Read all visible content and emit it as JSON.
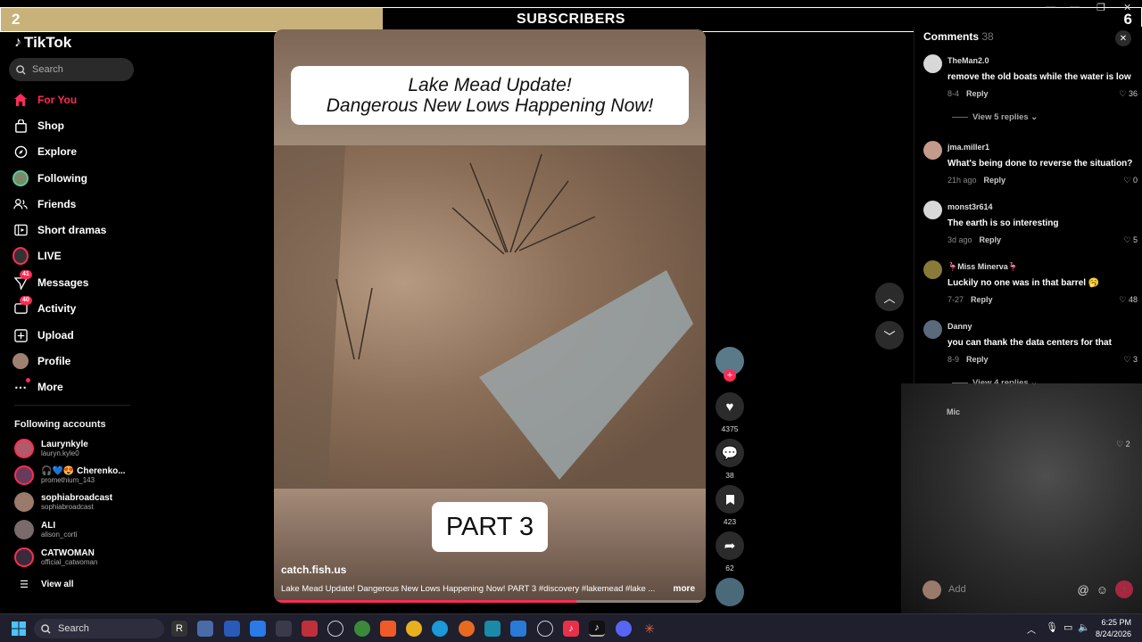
{
  "overlay": {
    "left_num": "2",
    "right_num": "6",
    "center": "SUBSCRIBERS",
    "progress_fraction": 0.335
  },
  "app": {
    "name": "TikTok"
  },
  "search": {
    "placeholder": "Search"
  },
  "nav": [
    {
      "label": "For You",
      "icon": "home-icon",
      "active": true
    },
    {
      "label": "Shop",
      "icon": "shop-bag-icon"
    },
    {
      "label": "Explore",
      "icon": "compass-icon"
    },
    {
      "label": "Following",
      "icon": "avatar-icon"
    },
    {
      "label": "Friends",
      "icon": "friends-icon"
    },
    {
      "label": "Short dramas",
      "icon": "film-icon"
    },
    {
      "label": "LIVE",
      "icon": "live-icon"
    },
    {
      "label": "Messages",
      "icon": "paper-plane-icon",
      "badge": "41"
    },
    {
      "label": "Activity",
      "icon": "inbox-icon",
      "badge": "40"
    },
    {
      "label": "Upload",
      "icon": "plus-square-icon"
    },
    {
      "label": "Profile",
      "icon": "avatar-icon"
    },
    {
      "label": "More",
      "icon": "ellipsis-icon"
    }
  ],
  "following_accounts": {
    "title": "Following accounts",
    "items": [
      {
        "name": "Laurynkyle",
        "handle": "lauryn.kyle0"
      },
      {
        "name": "🎧💙😍 Cherenko...",
        "handle": "promethium_143"
      },
      {
        "name": "sophiabroadcast",
        "handle": "sophiabroadcast"
      },
      {
        "name": "ALI",
        "handle": "alison_corti"
      },
      {
        "name": "CATWOMAN",
        "handle": "official_catwoman"
      }
    ],
    "view_all": "View all"
  },
  "video": {
    "title_line1": "Lake Mead Update!",
    "title_line2": "Dangerous New Lows Happening Now!",
    "part_label": "PART 3",
    "author": "catch.fish.us",
    "description": "Lake Mead Update! Dangerous New Lows Happening Now! PART 3 #discovery #lakemead #lake ...",
    "more": "more",
    "progress_fraction": 0.7
  },
  "actions": {
    "likes": "4375",
    "comments": "38",
    "saves": "423",
    "shares": "62"
  },
  "comments": {
    "title": "Comments",
    "count": "38",
    "reply_label": "Reply",
    "items": [
      {
        "user": "TheMan2.0",
        "text": "remove the old boats while the water is low",
        "date": "8-4",
        "likes": "36",
        "avatar_color": "#d8d8d8"
      },
      {
        "user": "jma.miller1",
        "text": "What's being done to reverse the situation?",
        "date": "21h ago",
        "likes": "0",
        "avatar_color": "#c49a8a"
      },
      {
        "user": "monst3r614",
        "text": "The earth is so interesting",
        "date": "3d ago",
        "likes": "5",
        "avatar_color": "#d8d8d8"
      },
      {
        "user": "🦩Miss Minerva🦩",
        "text": "Luckily no one was in that barrel 🥱",
        "date": "7-27",
        "likes": "48",
        "avatar_color": "#8a7a3a"
      },
      {
        "user": "Danny",
        "text": "you can thank the data centers for that",
        "date": "8-9",
        "likes": "3",
        "avatar_color": "#5a6a7a"
      }
    ],
    "view_replies_1": "View 5 replies",
    "view_replies_2": "View 4 replies",
    "partial_user": "Mic",
    "partial_likes": "2",
    "add_placeholder": "Add"
  },
  "taskbar": {
    "search": "Search",
    "time": "6:25 PM",
    "date": "8/24/2026"
  },
  "colors": {
    "accent": "#fe2c55",
    "overlay_fill": "#c8b27a"
  }
}
